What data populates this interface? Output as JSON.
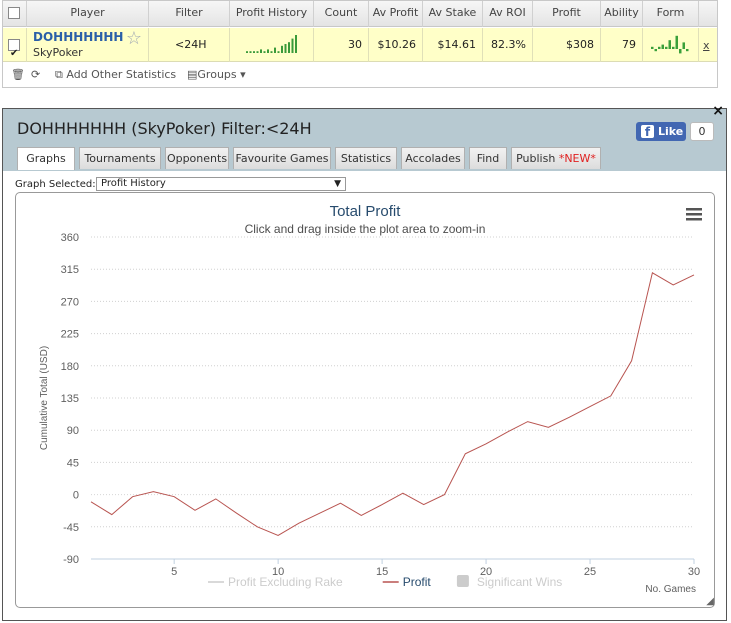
{
  "table": {
    "headers": [
      "",
      "Player",
      "Filter",
      "Profit History",
      "Count",
      "Av Profit",
      "Av Stake",
      "Av ROI",
      "Profit",
      "Ability",
      "Form"
    ],
    "row": {
      "checked": true,
      "player_name": "DOHHHHHHH",
      "player_site": "SkyPoker",
      "filter": "<24H",
      "count": "30",
      "av_profit": "$10.26",
      "av_stake": "$14.61",
      "av_roi": "82.3%",
      "profit": "$308",
      "ability": "79",
      "remove": "x",
      "profit_history_spark": [
        1,
        1,
        1,
        1,
        2,
        1,
        2,
        1,
        3,
        1,
        4,
        5,
        6,
        8,
        10
      ],
      "form_bars": [
        1,
        -1,
        1,
        2,
        1,
        4,
        1,
        6,
        -2,
        3,
        -1
      ]
    },
    "toolbar": {
      "add_stats": "Add Other Statistics",
      "groups": "Groups"
    }
  },
  "dialog": {
    "title": "DOHHHHHHH (SkyPoker) Filter:<24H",
    "close": "×",
    "fb_like": "Like",
    "fb_count": "0",
    "tabs": [
      {
        "label": "Graphs",
        "active": true
      },
      {
        "label": "Tournaments"
      },
      {
        "label": "Opponents"
      },
      {
        "label": "Favourite Games"
      },
      {
        "label": "Statistics"
      },
      {
        "label": "Accolades"
      },
      {
        "label": "Find"
      },
      {
        "label": "Publish",
        "badge": "*NEW*"
      }
    ],
    "graph_selected_label": "Graph Selected:",
    "graph_selected_value": "Profit History"
  },
  "chart_data": {
    "type": "line",
    "title": "Total Profit",
    "subtitle": "Click and drag inside the plot area to zoom-in",
    "ylabel": "Cumulative Total (USD)",
    "xlabel": "No. Games",
    "ylim": [
      -90,
      360
    ],
    "yticks": [
      -90,
      -45,
      0,
      45,
      90,
      135,
      180,
      225,
      270,
      315,
      360
    ],
    "xlim": [
      1,
      30
    ],
    "xticks": [
      5,
      10,
      15,
      20,
      25,
      30
    ],
    "grid": true,
    "legend_position": "bottom",
    "legend": [
      {
        "name": "Profit Excluding Rake",
        "color": "#cccccc",
        "kind": "line",
        "enabled": false
      },
      {
        "name": "Profit",
        "color": "#b85450",
        "kind": "line",
        "enabled": true
      },
      {
        "name": "Significant Wins",
        "color": "#cccccc",
        "kind": "box",
        "enabled": false
      }
    ],
    "series": [
      {
        "name": "Profit",
        "color": "#b85450",
        "x": [
          1,
          2,
          3,
          4,
          5,
          6,
          7,
          8,
          9,
          10,
          11,
          12,
          13,
          14,
          15,
          16,
          17,
          18,
          19,
          20,
          21,
          22,
          23,
          24,
          25,
          26,
          27,
          28,
          29,
          30
        ],
        "values": [
          -10,
          -28,
          -3,
          4,
          -3,
          -22,
          -6,
          -26,
          -45,
          -57,
          -40,
          -26,
          -12,
          -29,
          -14,
          2,
          -14,
          0,
          57,
          71,
          87,
          102,
          94,
          108,
          123,
          138,
          187,
          310,
          293,
          307
        ]
      }
    ]
  }
}
